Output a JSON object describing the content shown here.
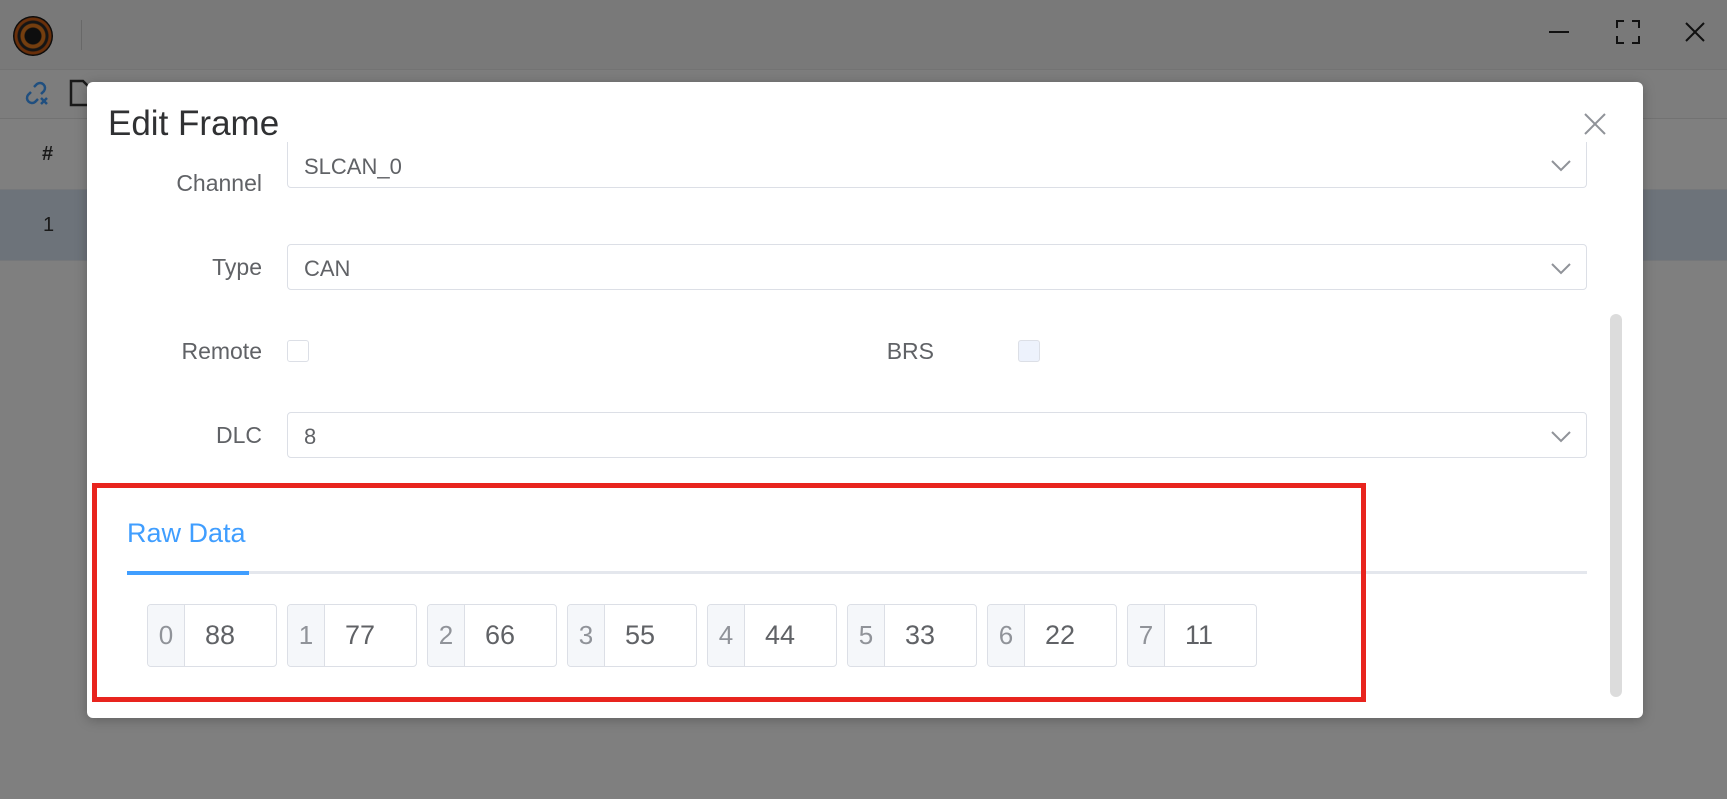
{
  "table": {
    "header_hash": "#",
    "row_index": "1"
  },
  "dialog": {
    "title": "Edit Frame",
    "channel": {
      "label": "Channel",
      "value": "SLCAN_0"
    },
    "type": {
      "label": "Type",
      "value": "CAN"
    },
    "remote": {
      "label": "Remote",
      "checked": false
    },
    "brs": {
      "label": "BRS",
      "checked": false,
      "disabled": true
    },
    "dlc": {
      "label": "DLC",
      "value": "8"
    },
    "tab": {
      "label": "Raw Data"
    },
    "bytes": [
      {
        "index": "0",
        "value": "88"
      },
      {
        "index": "1",
        "value": "77"
      },
      {
        "index": "2",
        "value": "66"
      },
      {
        "index": "3",
        "value": "55"
      },
      {
        "index": "4",
        "value": "44"
      },
      {
        "index": "5",
        "value": "33"
      },
      {
        "index": "6",
        "value": "22"
      },
      {
        "index": "7",
        "value": "11"
      }
    ]
  },
  "colors": {
    "accent": "#409eff",
    "highlight": "#e8241e",
    "overlay": "rgba(0,0,0,0.5)"
  },
  "icons": [
    "app-logo",
    "minimize-icon",
    "maximize-icon",
    "close-icon",
    "link-off-icon",
    "file-icon",
    "dialog-close-icon",
    "chevron-down-icon"
  ]
}
